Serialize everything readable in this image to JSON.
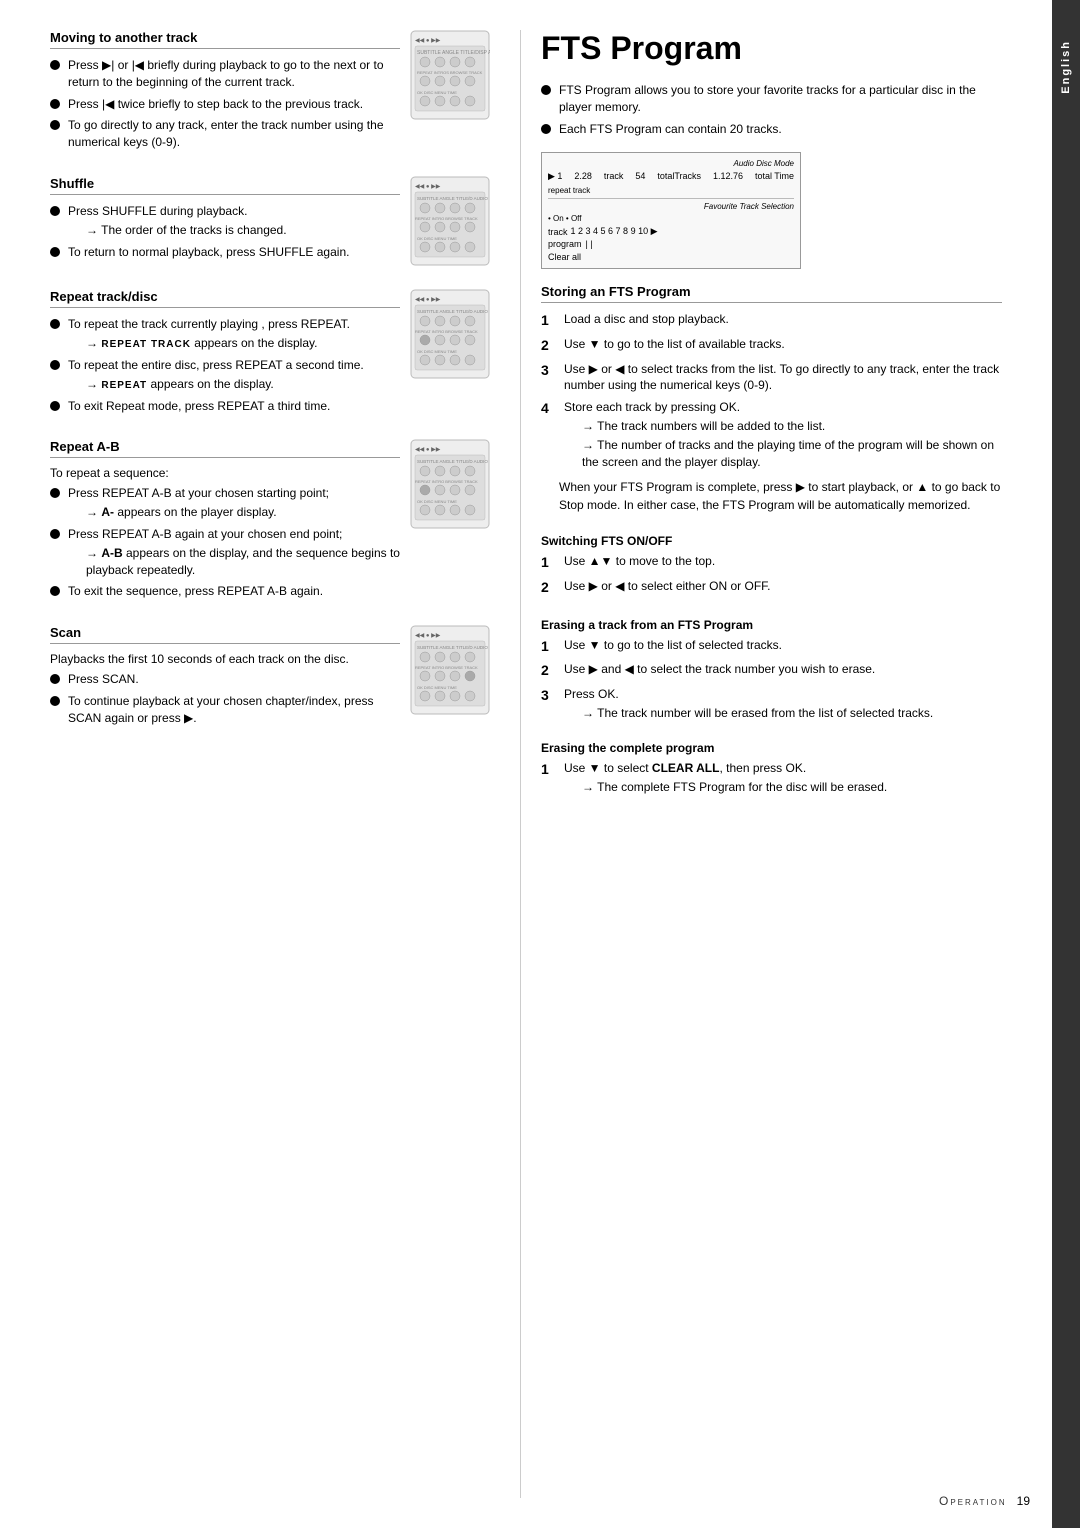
{
  "sidebar": {
    "label": "English"
  },
  "left": {
    "sections": [
      {
        "id": "moving-to-another-track",
        "title": "Moving to another track",
        "has_remote": true,
        "bullets": [
          {
            "text": "Press ▶| or |◀ briefly during playback to go to the next or to return to the beginning of the current track."
          },
          {
            "text": "Press |◀ twice briefly to step back to the previous track."
          },
          {
            "text": "To go directly to any track, enter the track number using the numerical keys (0-9)."
          }
        ]
      },
      {
        "id": "shuffle",
        "title": "Shuffle",
        "has_remote": true,
        "bullets": [
          {
            "text": "Press SHUFFLE during playback.",
            "note": "The order of the tracks is changed."
          },
          {
            "text": "To return to normal playback, press SHUFFLE again."
          }
        ]
      },
      {
        "id": "repeat-track-disc",
        "title": "Repeat track/disc",
        "has_remote": true,
        "bullets": [
          {
            "text": "To repeat the track currently playing , press REPEAT.",
            "note_smallcaps": "REPEAT TRACK appears on the display."
          },
          {
            "text": "To repeat the entire disc, press REPEAT a second time.",
            "note_smallcaps": "REPEAT appears on the display."
          },
          {
            "text": "To exit Repeat mode, press REPEAT a third time."
          }
        ]
      },
      {
        "id": "repeat-a-b",
        "title": "Repeat A-B",
        "has_remote": true,
        "intro": "To repeat a sequence:",
        "bullets": [
          {
            "text": "Press REPEAT A-B at your chosen starting point;",
            "note": "A- appears on the player display."
          },
          {
            "text": "Press REPEAT A-B again at your chosen end point;",
            "note": "A-B appears on the display, and the sequence begins to playback repeatedly."
          },
          {
            "text": "To exit the sequence, press REPEAT A-B again."
          }
        ]
      },
      {
        "id": "scan",
        "title": "Scan",
        "has_remote": true,
        "intro": "Playbacks the first 10 seconds of each track on the disc.",
        "bullets": [
          {
            "text": "Press SCAN."
          },
          {
            "text": "To continue playback at your chosen chapter/index, press SCAN again or press ▶."
          }
        ]
      }
    ]
  },
  "right": {
    "page_title": "FTS Program",
    "intro_bullets": [
      {
        "text": "FTS Program allows you to store your favorite tracks for a particular disc in the player memory."
      },
      {
        "text": "Each FTS Program can contain 20 tracks."
      }
    ],
    "storing_section": {
      "title": "Storing an FTS Program",
      "steps": [
        {
          "num": "1",
          "text": "Load a disc and stop playback."
        },
        {
          "num": "2",
          "text": "Use ▼ to go to the list of available tracks."
        },
        {
          "num": "3",
          "text": "Use ▶ or ◀ to select tracks from the list. To go directly to any track, enter the track number using the numerical keys (0-9)."
        },
        {
          "num": "4",
          "text": "Store each track by pressing OK.",
          "notes": [
            "The track numbers will be added to the list.",
            "The number of tracks and the playing time of the program will be shown on the screen and the player display."
          ]
        },
        {
          "num": "",
          "text": "When your FTS Program is complete, press ▶ to start playback, or ▲ to go back to Stop mode. In either case, the FTS Program will be automatically memorized.",
          "is_para": true
        }
      ]
    },
    "switching_section": {
      "title": "Switching FTS ON/OFF",
      "steps": [
        {
          "num": "1",
          "text": "Use ▲▼ to move to the top."
        },
        {
          "num": "2",
          "text": "Use ▶ or ◀ to select either ON or OFF."
        }
      ]
    },
    "erasing_track_section": {
      "title": "Erasing a track from an FTS Program",
      "steps": [
        {
          "num": "1",
          "text": "Use ▼ to go to the list of selected tracks."
        },
        {
          "num": "2",
          "text": "Use ▶ and ◀ to select the track number you wish to erase."
        },
        {
          "num": "3",
          "text": "Press OK.",
          "notes": [
            "The track number will be erased from the list of selected tracks."
          ]
        }
      ]
    },
    "erasing_complete_section": {
      "title": "Erasing the complete program",
      "steps": [
        {
          "num": "1",
          "text": "Use ▼ to select CLEAR ALL, then press OK.",
          "bold_part": "CLEAR ALL",
          "notes": [
            "The complete FTS Program for the disc will be erased."
          ]
        }
      ]
    }
  },
  "footer": {
    "operation_label": "Operation",
    "page_number": "19"
  }
}
